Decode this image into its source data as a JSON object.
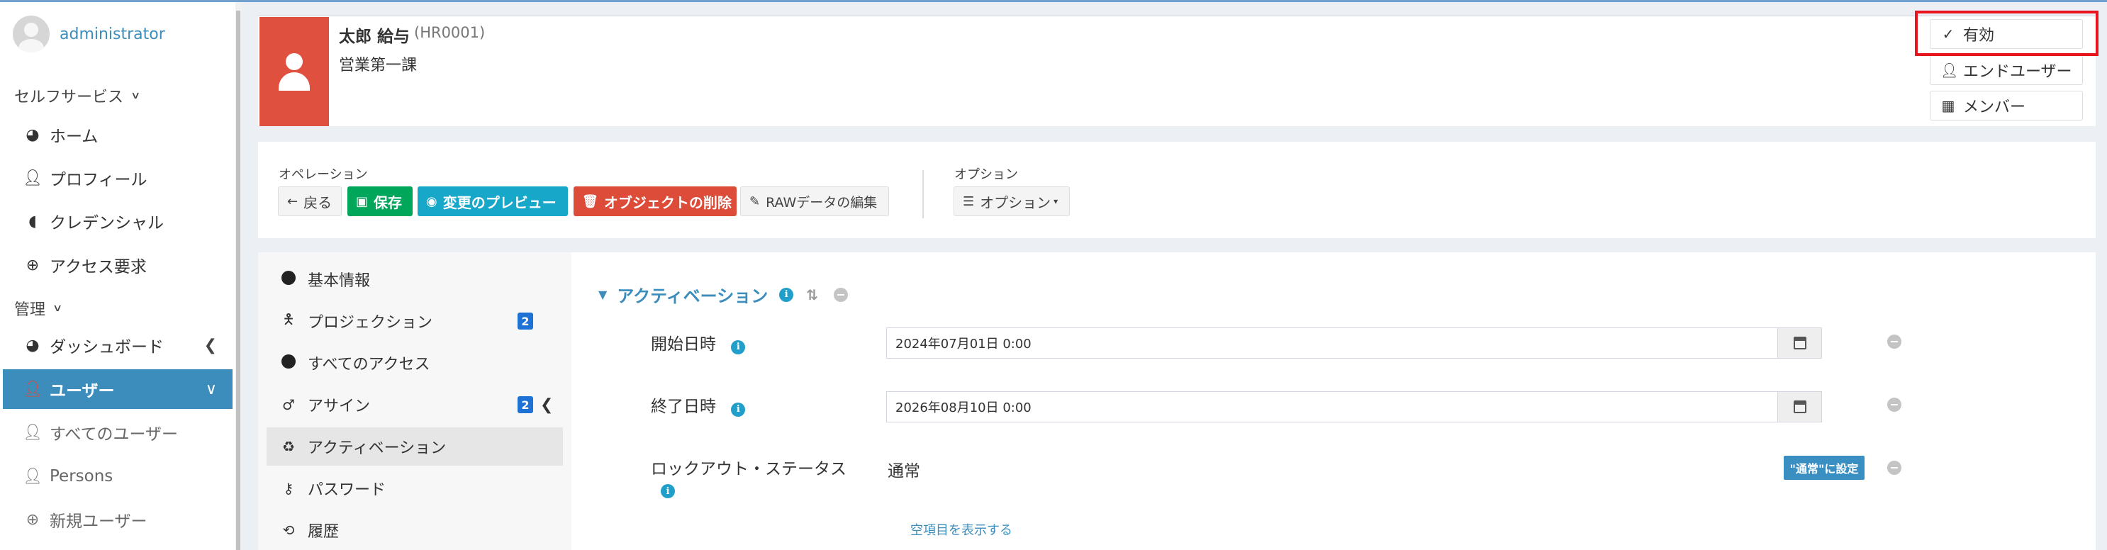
{
  "sidebar": {
    "user_name": "administrator",
    "self_service_header": "セルフサービス",
    "self_service_items": [
      {
        "label": "ホーム",
        "icon": "dashboard-icon"
      },
      {
        "label": "プロフィール",
        "icon": "user-icon"
      },
      {
        "label": "クレデンシャル",
        "icon": "shield-icon"
      },
      {
        "label": "アクセス要求",
        "icon": "plus-circle-icon"
      }
    ],
    "admin_header": "管理",
    "admin_items": [
      {
        "label": "ダッシュボード",
        "icon": "dashboard-icon"
      },
      {
        "label": "ユーザー",
        "icon": "user-icon",
        "active": true
      },
      {
        "label": "すべてのユーザー",
        "icon": "user-icon"
      },
      {
        "label": "Persons",
        "icon": "user-icon"
      },
      {
        "label": "新規ユーザー",
        "icon": "plus-circle-icon"
      }
    ]
  },
  "profile": {
    "name": "太郎 給与",
    "key": "(HR0001)",
    "department": "営業第一課",
    "status_buttons": [
      {
        "label": "有効",
        "icon": "check-icon"
      },
      {
        "label": "エンドユーザー",
        "icon": "user-icon"
      },
      {
        "label": "メンバー",
        "icon": "building-icon"
      }
    ]
  },
  "operations": {
    "label": "オペレーション",
    "back": "戻る",
    "save": "保存",
    "preview": "変更のプレビュー",
    "delete": "オブジェクトの削除",
    "raw_edit": "RAWデータの編集",
    "options_label": "オプション",
    "options_button": "オプション"
  },
  "tabs": [
    {
      "label": "基本情報",
      "icon": "circle-icon"
    },
    {
      "label": "プロジェクション",
      "icon": "person-icon",
      "badge": "2"
    },
    {
      "label": "すべてのアクセス",
      "icon": "circle-icon"
    },
    {
      "label": "アサイン",
      "icon": "male-icon",
      "badge": "2"
    },
    {
      "label": "アクティベーション",
      "icon": "recycle-icon",
      "active": true
    },
    {
      "label": "パスワード",
      "icon": "key-icon"
    },
    {
      "label": "履歴",
      "icon": "history-icon"
    }
  ],
  "activation": {
    "title": "アクティベーション",
    "fields": [
      {
        "label": "開始日時",
        "value": "2024年07月01日 0:00"
      },
      {
        "label": "終了日時",
        "value": "2026年08月10日 0:00"
      }
    ],
    "lockout_label": "ロックアウト・ステータス",
    "lockout_value": "通常",
    "set_normal_button": "\"通常\"に設定",
    "show_empty_link": "空項目を表示する"
  }
}
